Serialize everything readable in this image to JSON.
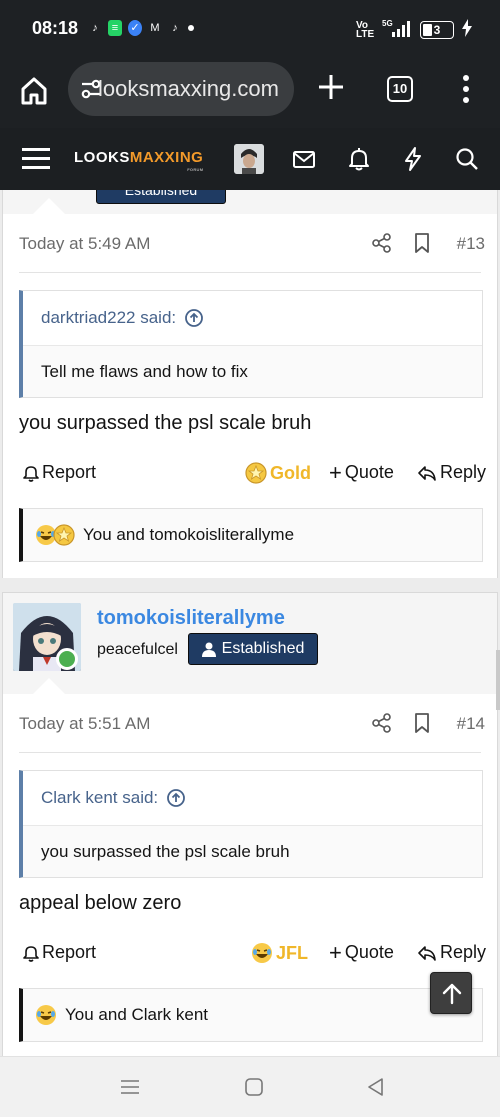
{
  "status_bar": {
    "time": "08:18",
    "network": "5G",
    "volte": "Vo LTE",
    "battery_level": "3",
    "notification_icons": [
      "tiktok-icon",
      "whatsapp-business-icon",
      "messenger-icon",
      "gmail-icon",
      "tiktok-icon",
      "dot-icon"
    ]
  },
  "browser": {
    "url": "looksmaxxing.com",
    "tab_count": "10"
  },
  "site_header": {
    "logo_white": "LOOKS",
    "logo_accent": "MAXXING",
    "logo_sub": "FORUM",
    "accent_color": "#f39a2a"
  },
  "previous_post": {
    "badge_label": "Established"
  },
  "posts": [
    {
      "timestamp": "Today at 5:49 AM",
      "number": "#13",
      "quote": {
        "author": "darktriad222 said:",
        "text": "Tell me flaws and how to fix"
      },
      "message": "you surpassed the psl scale bruh",
      "actions": {
        "report": "Report",
        "reaction": "Gold",
        "quote": "Quote",
        "reply": "Reply"
      },
      "reactions_text": "You and tomokoisliterallyme"
    },
    {
      "author": {
        "name": "tomokoisliterallyme",
        "title": "peacefulcel",
        "badge": "Established"
      },
      "timestamp": "Today at 5:51 AM",
      "number": "#14",
      "quote": {
        "author": "Clark kent said:",
        "text": "you surpassed the psl scale bruh"
      },
      "message": "appeal below zero",
      "actions": {
        "report": "Report",
        "reaction": "JFL",
        "quote": "Quote",
        "reply": "Reply"
      },
      "reactions_text": "You and Clark kent"
    }
  ],
  "colors": {
    "badge_bg": "#1f3b63",
    "username": "#3b88e1",
    "quote_border": "#5d7fa8",
    "reaction": "#f0b72a"
  }
}
